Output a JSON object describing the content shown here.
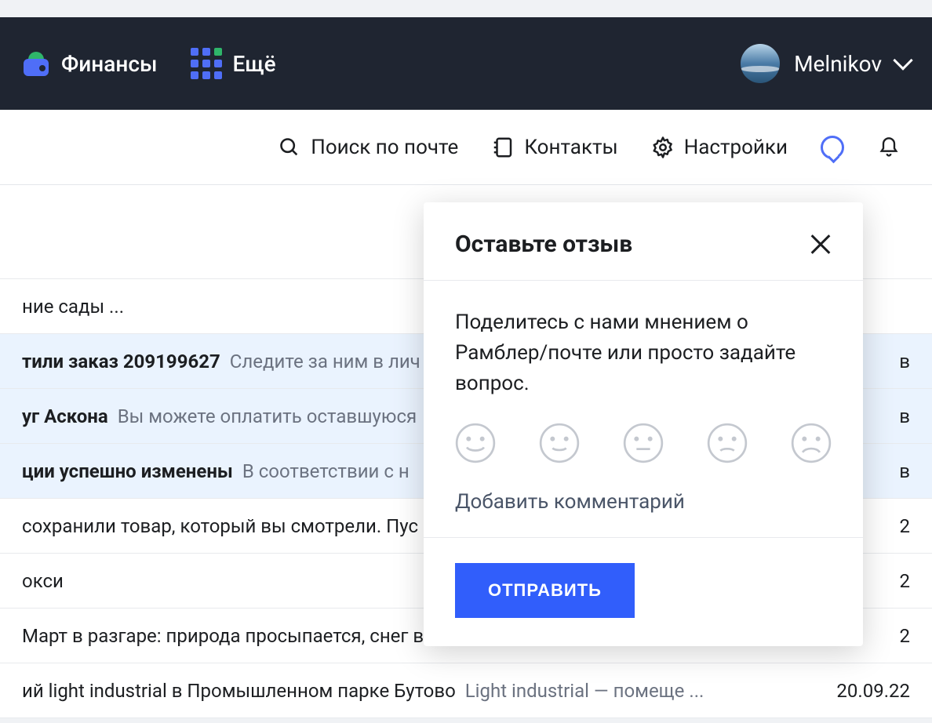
{
  "header": {
    "finance_label": "Финансы",
    "more_label": "Ещё",
    "username": "Melnikov"
  },
  "toolbar": {
    "search_label": "Поиск по почте",
    "contacts_label": "Контакты",
    "settings_label": "Настройки"
  },
  "mail": [
    {
      "subject": "ние сады ...",
      "preview": "",
      "date": "",
      "bold": false,
      "highlight": false
    },
    {
      "subject": "тили заказ 209199627",
      "preview": "Следите за ним в лич",
      "date": "в",
      "bold": true,
      "highlight": true
    },
    {
      "subject": "уг Аскона",
      "preview": "Вы можете оплатить оставшуюся",
      "date": "в",
      "bold": true,
      "highlight": true
    },
    {
      "subject": "ции успешно изменены",
      "preview": "В соответствии с н",
      "date": "в",
      "bold": true,
      "highlight": true
    },
    {
      "subject": "сохранили товар, который вы смотрели. Пус",
      "preview": "",
      "date": "2",
      "bold": false,
      "highlight": false
    },
    {
      "subject": "окси",
      "preview": "",
      "date": "2",
      "bold": false,
      "highlight": false
    },
    {
      "subject": "Март в разгаре: природа просыпается, снег в",
      "preview": "",
      "date": "2",
      "bold": false,
      "highlight": false
    },
    {
      "subject": "ий light industrial в Промышленном парке Бутово",
      "preview": "Light industrial — помеще ...",
      "date": "20.09.22",
      "bold": false,
      "highlight": false
    }
  ],
  "popup": {
    "title": "Оставьте отзыв",
    "body_text": "Поделитесь с нами мнением о Рамблер/почте или просто задайте вопрос.",
    "comment_label": "Добавить комментарий",
    "submit_label": "ОТПРАВИТЬ"
  }
}
